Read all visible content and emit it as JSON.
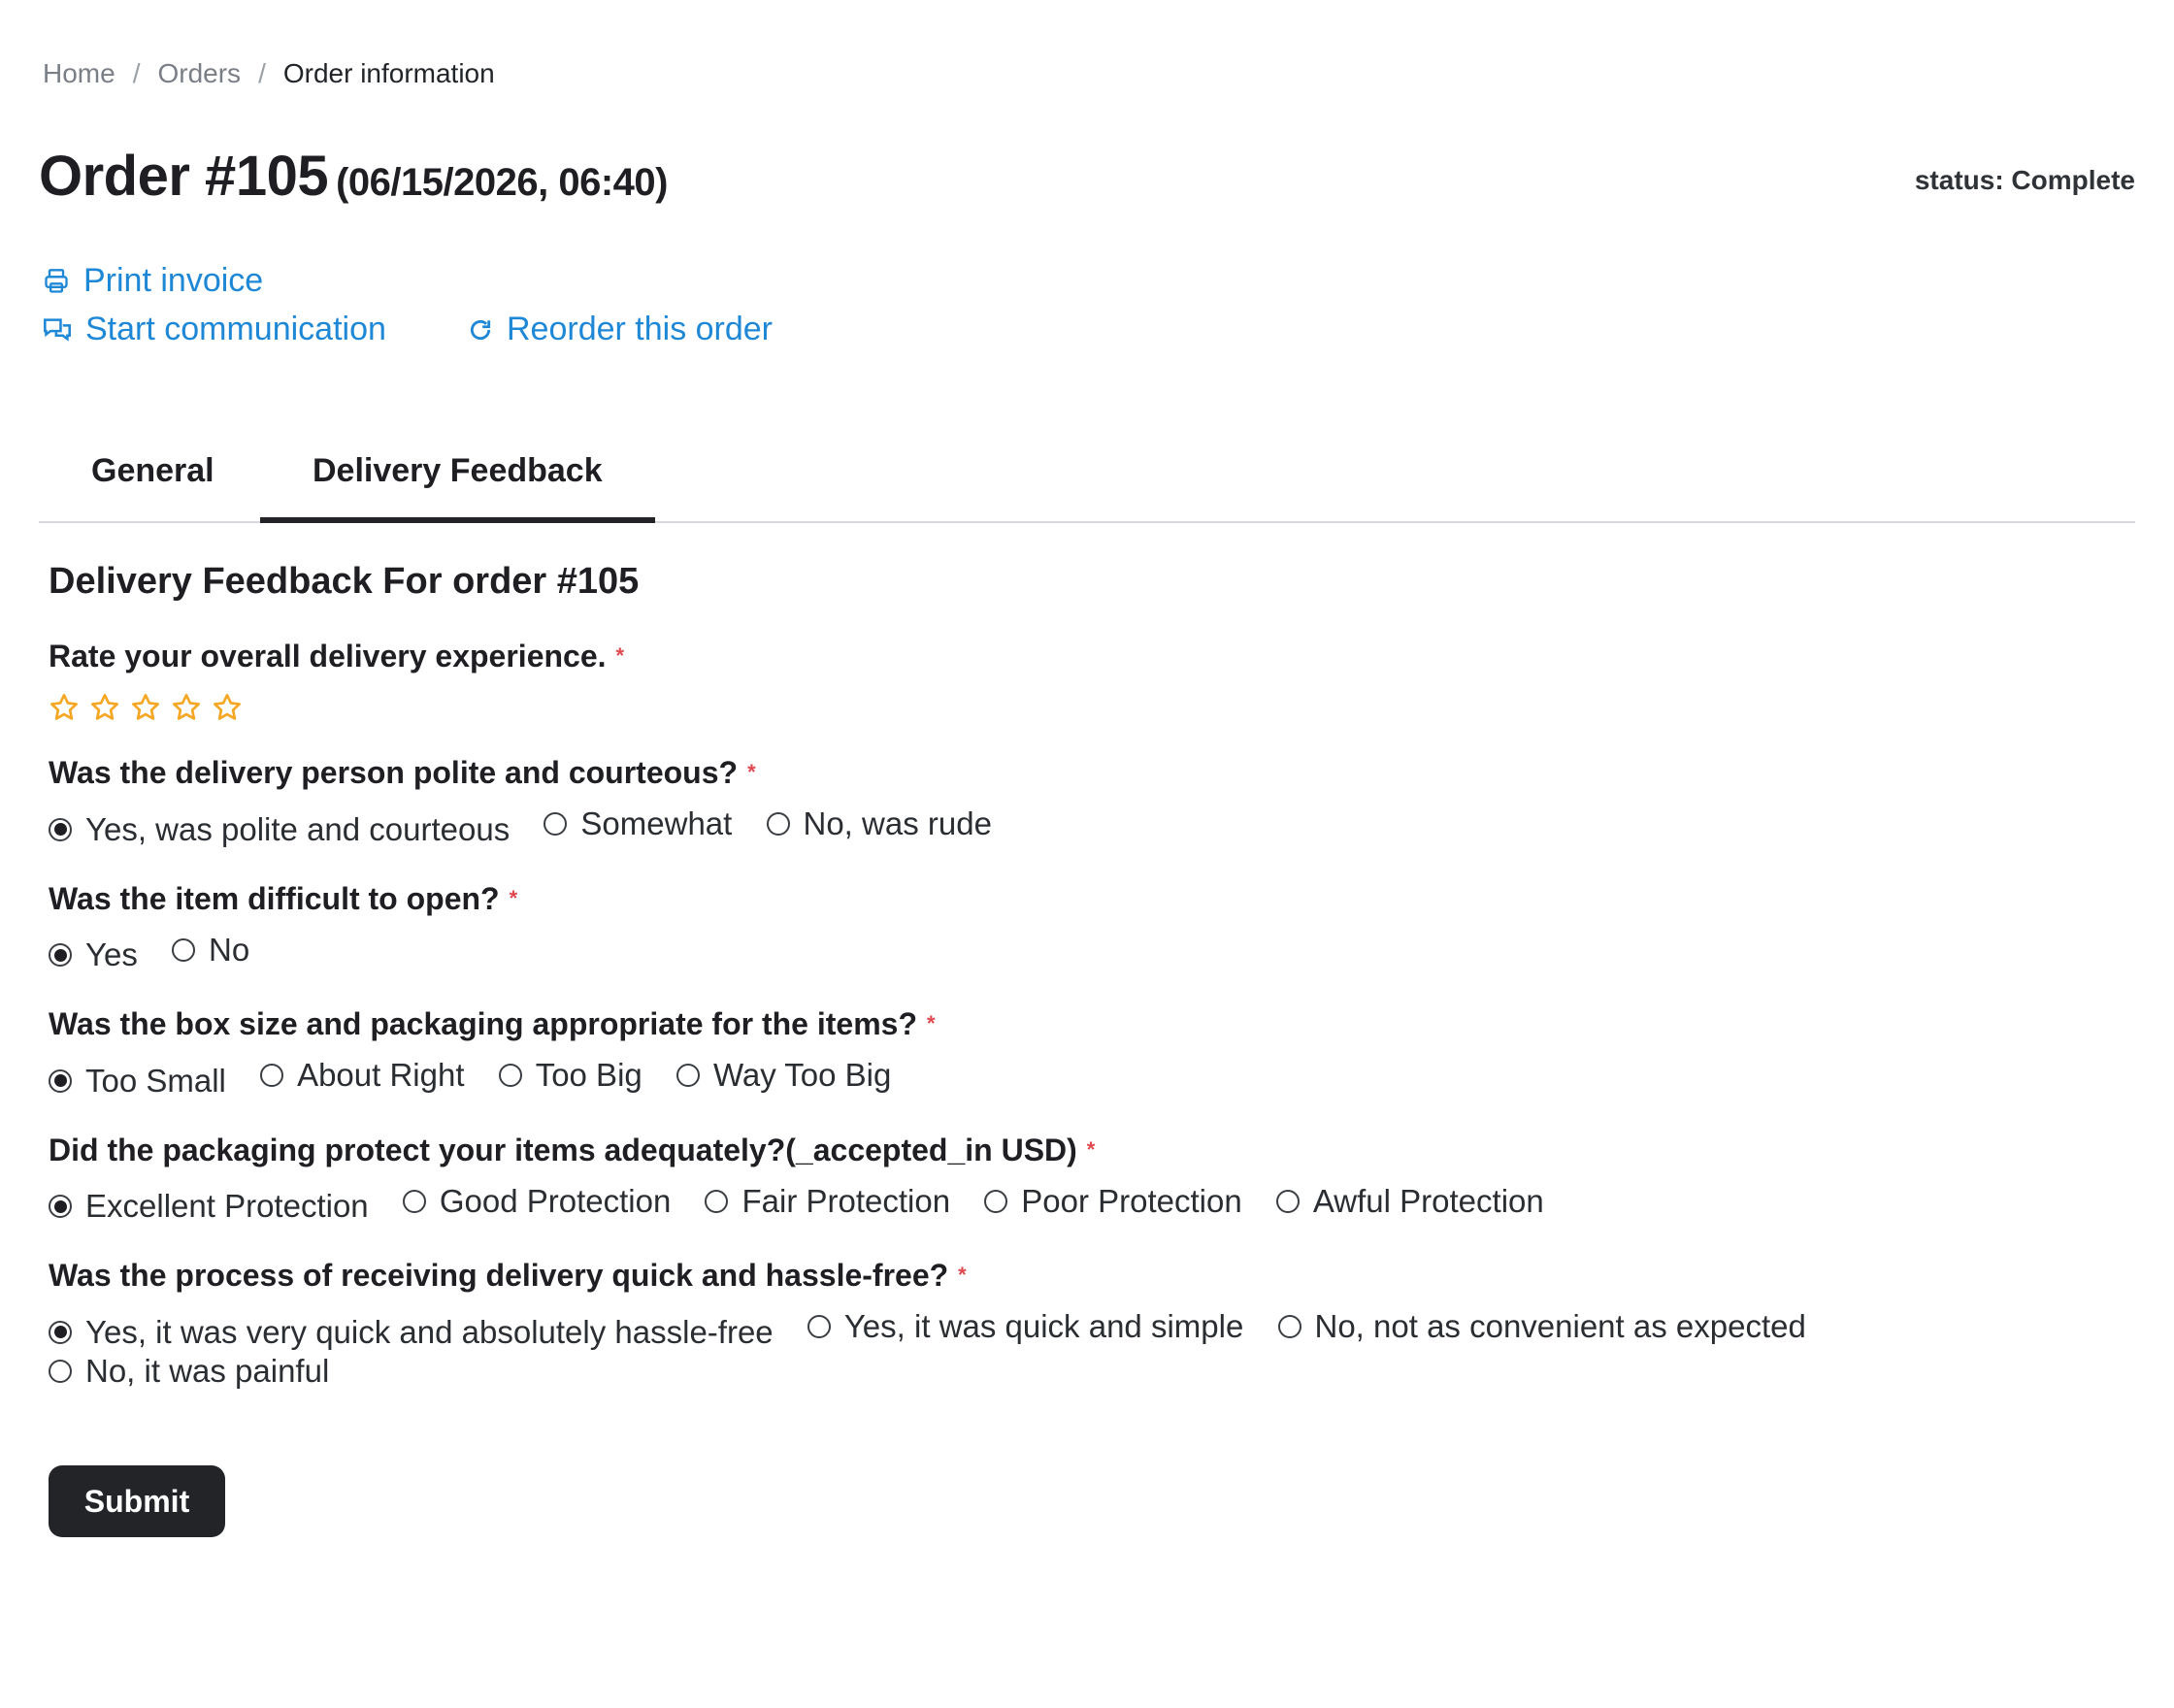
{
  "breadcrumb": {
    "home": "Home",
    "orders": "Orders",
    "current": "Order information"
  },
  "order": {
    "title": "Order #105",
    "date": "(06/15/2026, 06:40)",
    "status": "status: Complete"
  },
  "actions": {
    "print": "Print invoice",
    "communicate": "Start communication",
    "reorder": "Reorder this order"
  },
  "tabs": [
    {
      "label": "General",
      "active": false
    },
    {
      "label": "Delivery Feedback",
      "active": true
    }
  ],
  "form": {
    "title": "Delivery Feedback For order #105",
    "required_mark": "*",
    "rating": {
      "question": "Rate your overall delivery experience.",
      "max": 5,
      "value": 0
    },
    "q_polite": {
      "question": "Was the delivery person polite and courteous?",
      "options": [
        "Yes, was polite and courteous",
        "Somewhat",
        "No, was rude"
      ],
      "selected": 0
    },
    "q_open": {
      "question": "Was the item difficult to open?",
      "options": [
        "Yes",
        "No"
      ],
      "selected": 0
    },
    "q_box": {
      "question": "Was the box size and packaging appropriate for the items?",
      "options": [
        "Too Small",
        "About Right",
        "Too Big",
        "Way Too Big"
      ],
      "selected": 0
    },
    "q_protect": {
      "question": "Did the packaging protect your items adequately?(_accepted_in USD)",
      "options": [
        "Excellent Protection",
        "Good Protection",
        "Fair Protection",
        "Poor Protection",
        "Awful Protection"
      ],
      "selected": 0
    },
    "q_process": {
      "question": "Was the process of receiving delivery quick and hassle-free?",
      "options": [
        "Yes, it was very quick and absolutely hassle-free",
        "Yes, it was quick and simple",
        "No, not as convenient as expected",
        "No, it was painful"
      ],
      "selected": 0
    },
    "submit": "Submit"
  },
  "colors": {
    "link": "#1e88d6",
    "star": "#f5a623",
    "required": "#e0484f",
    "button": "#222428"
  }
}
